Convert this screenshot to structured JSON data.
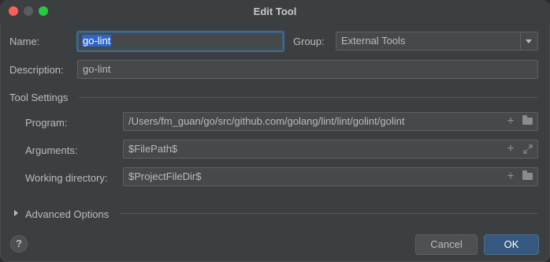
{
  "window": {
    "title": "Edit Tool"
  },
  "form": {
    "name_label": "Name:",
    "name_value": "go-lint",
    "group_label": "Group:",
    "group_value": "External Tools",
    "description_label": "Description:",
    "description_value": "go-lint"
  },
  "tool_settings": {
    "section_title": "Tool Settings",
    "program_label": "Program:",
    "program_value": "/Users/fm_guan/go/src/github.com/golang/lint/lint/golint/golint",
    "arguments_label": "Arguments:",
    "arguments_value": "$FilePath$",
    "working_dir_label": "Working directory:",
    "working_dir_value": "$ProjectFileDir$"
  },
  "advanced": {
    "label": "Advanced Options"
  },
  "footer": {
    "help_label": "?",
    "cancel_label": "Cancel",
    "ok_label": "OK"
  },
  "icons": {
    "add": "plus-icon",
    "browse": "folder-icon",
    "expand": "expand-icon",
    "dropdown": "chevron-down-icon",
    "disclosure": "disclosure-triangle-icon"
  },
  "colors": {
    "background": "#3c3f41",
    "field": "#45494a",
    "selection": "#2f65ca",
    "focus": "#3d6185",
    "ok_button": "#365880",
    "close": "#ff5f57",
    "maximize": "#28c840"
  }
}
